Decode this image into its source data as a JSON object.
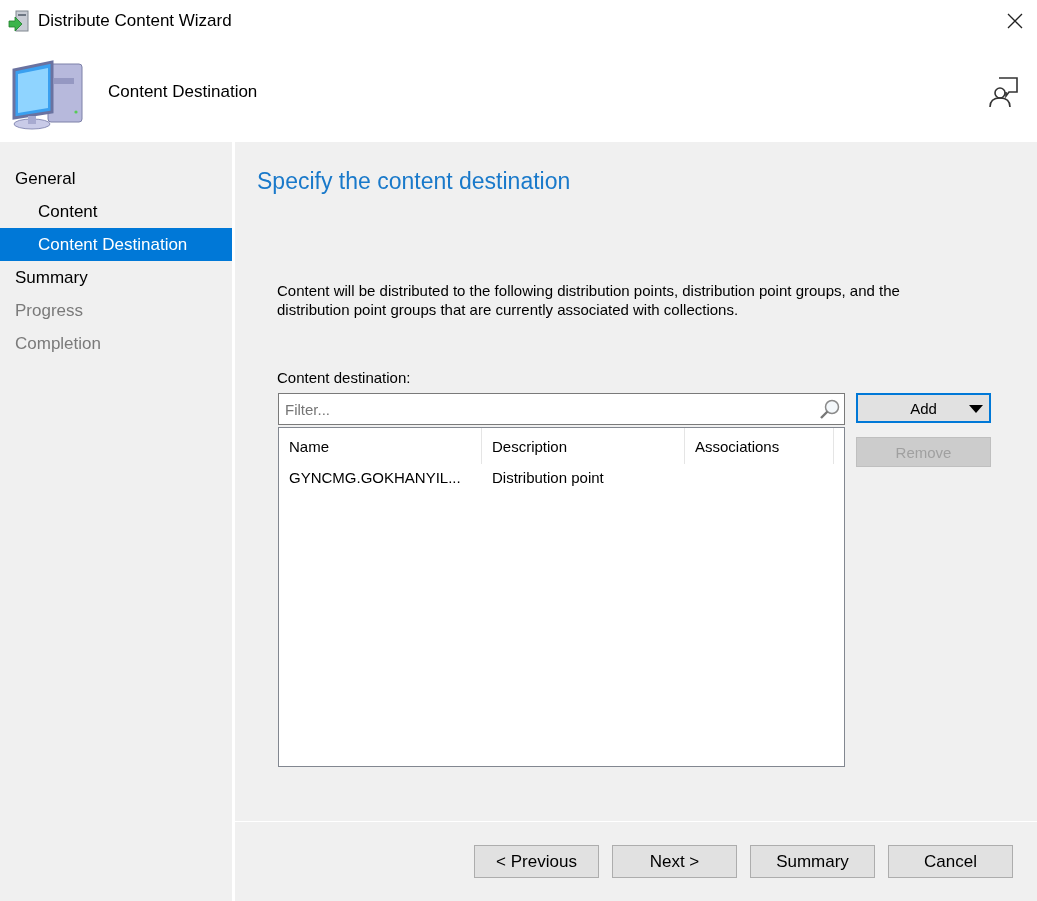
{
  "window": {
    "title": "Distribute Content Wizard"
  },
  "header": {
    "title": "Content Destination"
  },
  "sidebar": {
    "items": [
      {
        "label": "General",
        "selected": false,
        "disabled": false,
        "children": [
          {
            "label": "Content",
            "selected": false,
            "disabled": false
          },
          {
            "label": "Content Destination",
            "selected": true,
            "disabled": false
          }
        ]
      },
      {
        "label": "Summary",
        "selected": false,
        "disabled": false
      },
      {
        "label": "Progress",
        "selected": false,
        "disabled": true
      },
      {
        "label": "Completion",
        "selected": false,
        "disabled": true
      }
    ]
  },
  "page": {
    "heading": "Specify the content destination",
    "description": "Content will be distributed to the following distribution points, distribution point groups, and the distribution point groups that are currently associated with collections.",
    "list_label": "Content destination:",
    "filter": {
      "placeholder": "Filter..."
    },
    "table": {
      "columns": [
        "Name",
        "Description",
        "Associations"
      ],
      "rows": [
        [
          "GYNCMG.GOKHANYIL...",
          "Distribution point",
          ""
        ]
      ]
    },
    "side_buttons": [
      {
        "label": "Add",
        "dropdown": true,
        "disabled": false,
        "focused": true
      },
      {
        "label": "Remove",
        "dropdown": false,
        "disabled": true,
        "focused": false
      }
    ]
  },
  "footer_buttons": [
    {
      "label": "< Previous",
      "disabled": false
    },
    {
      "label": "Next >",
      "disabled": false
    },
    {
      "label": "Summary",
      "disabled": false
    },
    {
      "label": "Cancel",
      "disabled": false
    }
  ]
}
